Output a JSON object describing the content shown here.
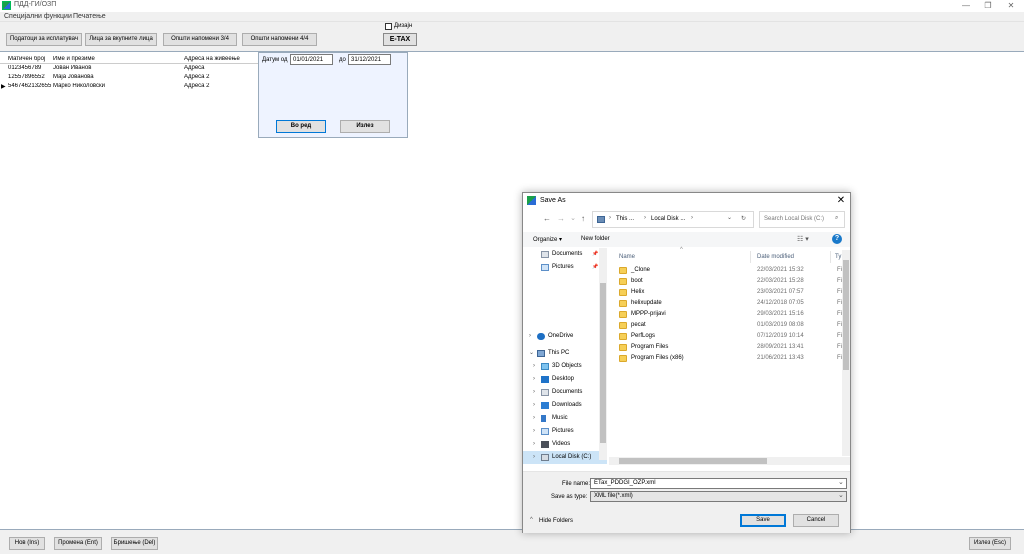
{
  "window": {
    "title": "ПДД-ГИ/ОЗП",
    "controls": [
      "—",
      "❐",
      "✕"
    ]
  },
  "menu": [
    "Специјални функции",
    "Печатење"
  ],
  "toolbar": {
    "buttons": [
      "Податоци за исплатувач",
      "Лица за вкупните лица",
      "Општи напомени 3/4",
      "Општи напомени 4/4"
    ],
    "dizajn_label": "Дизајн",
    "etax_label": "E-TAX"
  },
  "grid": {
    "headers": [
      "Матичен број",
      "Име и презиме",
      "Адреса на живеење"
    ],
    "rows": [
      [
        "0123456789",
        "Јован Иванов",
        "Адреса"
      ],
      [
        "12557896552",
        "Маја Јованова",
        "Адреса 2"
      ],
      [
        "5467462132655",
        "Марко Николовски",
        "Адреса 2"
      ]
    ],
    "selected_row_marker": "▶"
  },
  "date_panel": {
    "from_label": "Датум од",
    "from_value": "01/01/2021",
    "to_label": "до",
    "to_value": "31/12/2021",
    "ok_label": "Во ред",
    "exit_label": "Излез"
  },
  "bottom": {
    "new_label": "Нов (Ins)",
    "edit_label": "Промена (Ent)",
    "delete_label": "Бришење (Del)",
    "exit_label": "Излез (Esc)"
  },
  "dialog": {
    "title": "Save As",
    "close": "✕",
    "nav": {
      "back": "←",
      "forward": "→",
      "recent": "⌄",
      "up": "↑"
    },
    "breadcrumb": [
      "This ...",
      "Local Disk ..."
    ],
    "search_placeholder": "Search Local Disk (C:)",
    "organize_label": "Organize ▾",
    "new_folder_label": "New folder",
    "view_icon": "☷ ▾",
    "help_icon": "?",
    "nav_pane": [
      {
        "label": "Documents",
        "indent": 2,
        "arrow": "",
        "pin": "📌"
      },
      {
        "label": "Pictures",
        "indent": 2,
        "arrow": "",
        "pin": "📌"
      },
      {
        "label": "OneDrive",
        "indent": 1,
        "arrow": "›",
        "pin": ""
      },
      {
        "label": "This PC",
        "indent": 1,
        "arrow": "⌄",
        "pin": ""
      },
      {
        "label": "3D Objects",
        "indent": 2,
        "arrow": "›",
        "pin": ""
      },
      {
        "label": "Desktop",
        "indent": 2,
        "arrow": "›",
        "pin": ""
      },
      {
        "label": "Documents",
        "indent": 2,
        "arrow": "›",
        "pin": ""
      },
      {
        "label": "Downloads",
        "indent": 2,
        "arrow": "›",
        "pin": ""
      },
      {
        "label": "Music",
        "indent": 2,
        "arrow": "›",
        "pin": ""
      },
      {
        "label": "Pictures",
        "indent": 2,
        "arrow": "›",
        "pin": ""
      },
      {
        "label": "Videos",
        "indent": 2,
        "arrow": "›",
        "pin": ""
      },
      {
        "label": "Local Disk (C:)",
        "indent": 2,
        "arrow": "›",
        "pin": "",
        "selected": true
      }
    ],
    "columns": [
      "Name",
      "Date modified",
      "Ty"
    ],
    "files": [
      {
        "name": "_Clone",
        "date": "22/03/2021 15:32",
        "type": "Fi"
      },
      {
        "name": "boot",
        "date": "22/03/2021 15:28",
        "type": "Fi"
      },
      {
        "name": "Helix",
        "date": "23/03/2021 07:57",
        "type": "Fi"
      },
      {
        "name": "helixupdate",
        "date": "24/12/2018 07:05",
        "type": "Fi"
      },
      {
        "name": "MPPP-prijavi",
        "date": "29/03/2021 15:16",
        "type": "Fi"
      },
      {
        "name": "pecat",
        "date": "01/03/2019 08:08",
        "type": "Fi"
      },
      {
        "name": "PerfLogs",
        "date": "07/12/2019 10:14",
        "type": "Fi"
      },
      {
        "name": "Program Files",
        "date": "28/09/2021 13:41",
        "type": "Fi"
      },
      {
        "name": "Program Files (x86)",
        "date": "21/06/2021 13:43",
        "type": "Fi"
      }
    ],
    "file_name_label": "File name:",
    "file_name_value": "ETax_PDDGI_OZP.xml",
    "save_type_label": "Save as type:",
    "save_type_value": "XML file(*.xml)",
    "hide_folders_label": "Hide Folders",
    "save_label": "Save",
    "cancel_label": "Cancel"
  }
}
